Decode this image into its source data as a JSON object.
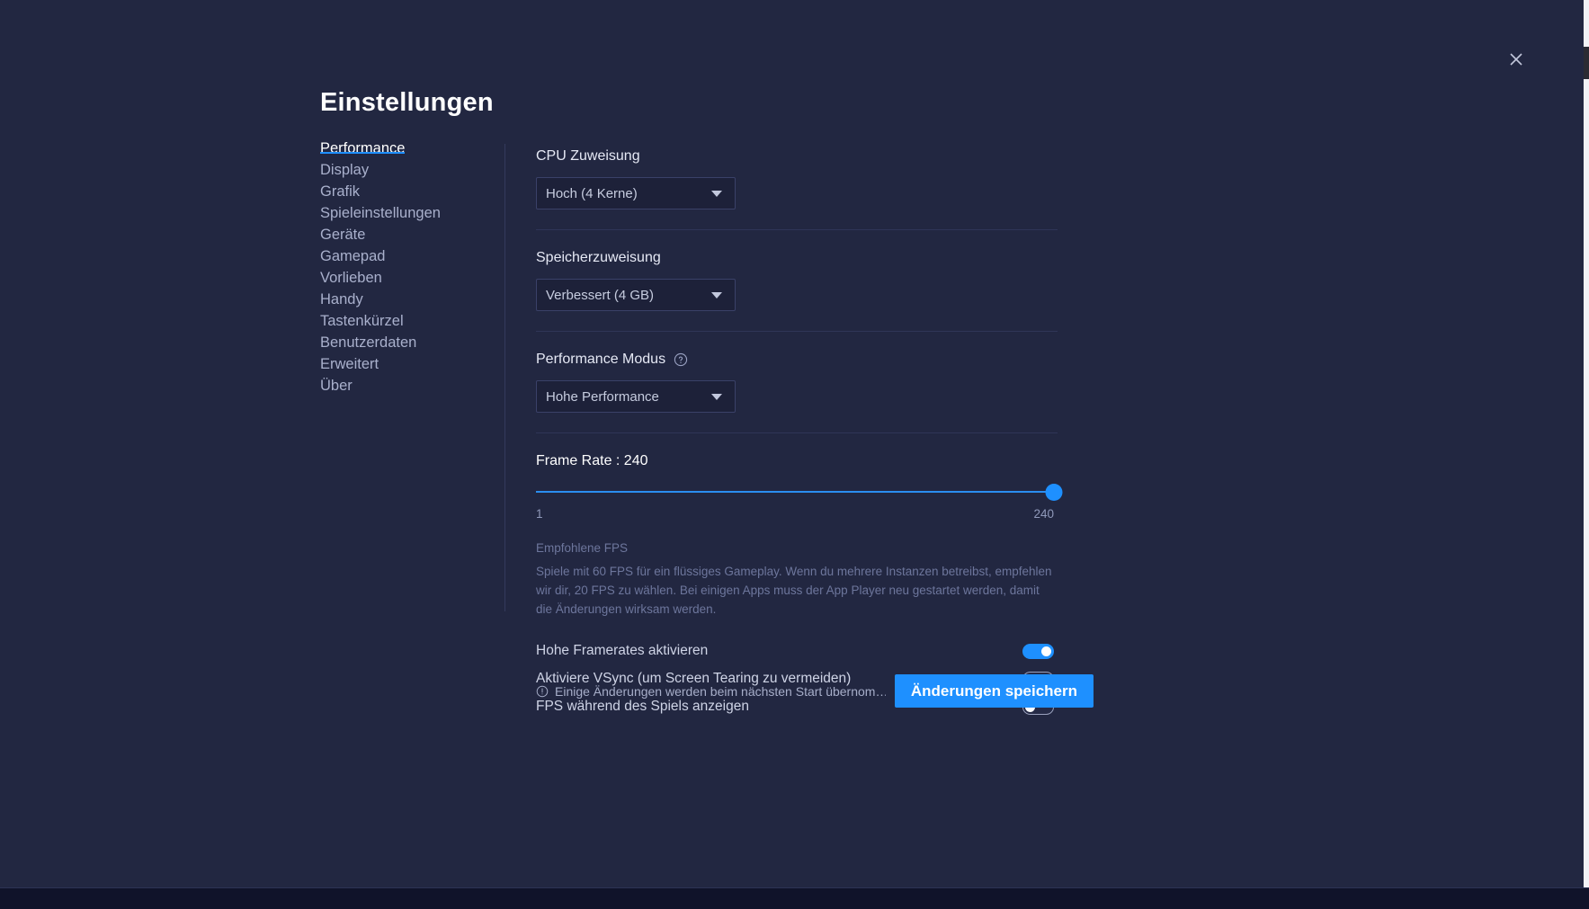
{
  "window": {
    "title": "Einstellungen",
    "close_icon": "close-icon"
  },
  "sidebar": {
    "items": [
      {
        "label": "Performance",
        "active": true
      },
      {
        "label": "Display",
        "active": false
      },
      {
        "label": "Grafik",
        "active": false
      },
      {
        "label": "Spieleinstellungen",
        "active": false
      },
      {
        "label": "Geräte",
        "active": false
      },
      {
        "label": "Gamepad",
        "active": false
      },
      {
        "label": "Vorlieben",
        "active": false
      },
      {
        "label": "Handy",
        "active": false
      },
      {
        "label": "Tastenkürzel",
        "active": false
      },
      {
        "label": "Benutzerdaten",
        "active": false
      },
      {
        "label": "Erweitert",
        "active": false
      },
      {
        "label": "Über",
        "active": false
      }
    ]
  },
  "main": {
    "cpu": {
      "label": "CPU Zuweisung",
      "value": "Hoch (4 Kerne)"
    },
    "memory": {
      "label": "Speicherzuweisung",
      "value": "Verbessert (4 GB)"
    },
    "performance_mode": {
      "label": "Performance Modus",
      "help_icon": "help-circle-icon",
      "value": "Hohe Performance"
    },
    "frame_rate": {
      "label": "Frame Rate : 240",
      "value": 240,
      "min": 1,
      "max": 240,
      "min_label": "1",
      "max_label": "240",
      "thumb_label": "240"
    },
    "fps_hint": {
      "title": "Empfohlene FPS",
      "body": "Spiele mit 60 FPS für ein flüssiges Gameplay. Wenn du mehrere Instanzen betreibst, empfehlen wir dir, 20 FPS zu wählen. Bei einigen Apps muss der App Player neu gestartet werden, damit die Änderungen wirksam werden."
    },
    "toggles": [
      {
        "label": "Hohe Framerates aktivieren",
        "state": "on"
      },
      {
        "label": "Aktiviere VSync (um Screen Tearing zu vermeiden)",
        "state": "off"
      },
      {
        "label": "FPS während des Spiels anzeigen",
        "state": "off"
      }
    ],
    "footer": {
      "info_icon": "info-circle-icon",
      "note": "Einige Änderungen werden beim nächsten Start übernom…",
      "save_label": "Änderungen speichern"
    }
  },
  "colors": {
    "accent": "#1e90ff",
    "modal_bg": "#222741",
    "divider": "#2f3557"
  }
}
